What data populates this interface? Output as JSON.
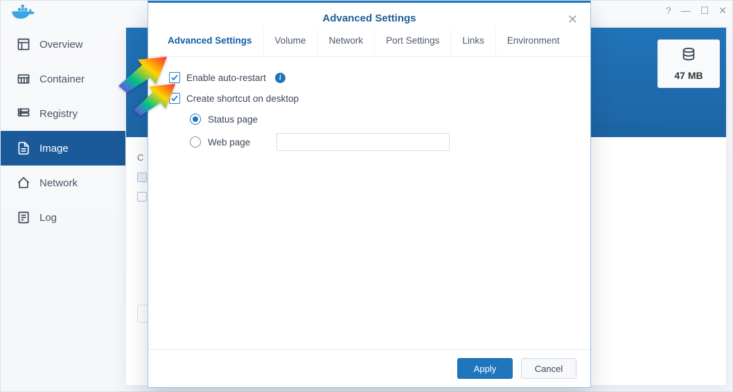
{
  "window": {
    "help_glyph": "?",
    "min_glyph": "—",
    "max_glyph": "☐",
    "close_glyph": "✕"
  },
  "sidebar": {
    "items": [
      {
        "label": "Overview"
      },
      {
        "label": "Container"
      },
      {
        "label": "Registry"
      },
      {
        "label": "Image"
      },
      {
        "label": "Network"
      },
      {
        "label": "Log"
      }
    ],
    "active_index": 3
  },
  "main_bg": {
    "stub_letter": "C",
    "size_value": "47 MB"
  },
  "modal": {
    "title": "Advanced Settings",
    "close_glyph": "✕",
    "tabs": [
      {
        "label": "Advanced Settings"
      },
      {
        "label": "Volume"
      },
      {
        "label": "Network"
      },
      {
        "label": "Port Settings"
      },
      {
        "label": "Links"
      },
      {
        "label": "Environment"
      }
    ],
    "active_tab": 0,
    "auto_restart": {
      "label": "Enable auto-restart",
      "checked": true,
      "info_glyph": "i"
    },
    "shortcut": {
      "label": "Create shortcut on desktop",
      "checked": true,
      "options": {
        "status": {
          "label": "Status page",
          "selected": true
        },
        "web": {
          "label": "Web page",
          "selected": false,
          "value": ""
        }
      }
    },
    "buttons": {
      "apply": "Apply",
      "cancel": "Cancel"
    }
  }
}
